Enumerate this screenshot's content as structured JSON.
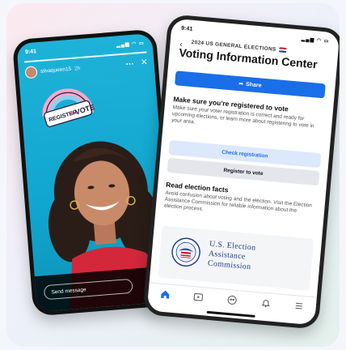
{
  "story": {
    "status_time": "9:41",
    "username": "silvaqueen15",
    "time_ago": "2h",
    "sticker_text_top": "REGISTER",
    "sticker_text_mid": "TO",
    "sticker_text_bottom": "VOTE",
    "message_placeholder": "Send message"
  },
  "voting": {
    "status_time": "9:41",
    "kicker": "2024 US GENERAL ELECTIONS",
    "title": "Voting Information Center",
    "share_label": "Share",
    "section1": {
      "heading": "Make sure you're registered to vote",
      "body": "Make sure your voter registration is correct and ready for upcoming elections, or learn more about registering to vote in your area."
    },
    "check_registration_label": "Check registration",
    "register_label": "Register to vote",
    "section2": {
      "heading": "Read election facts",
      "body": "Avoid confusion about voting and the election. Visit the Election Assistance Commission for reliable information about the election process."
    },
    "eac": {
      "line1": "U.S. Election",
      "line2": "Assistance",
      "line3": "Commission"
    },
    "accent_color": "#1a6ee8"
  }
}
